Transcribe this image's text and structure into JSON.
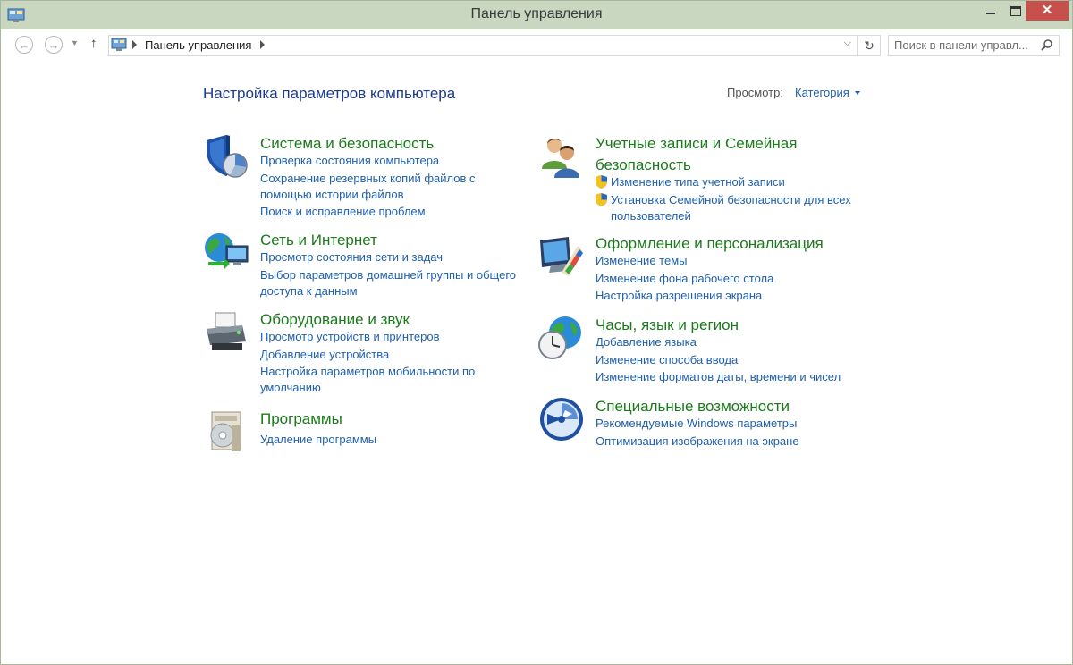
{
  "window": {
    "title": "Панель управления"
  },
  "navbar": {
    "breadcrumb": "Панель управления",
    "search_placeholder": "Поиск в панели управл..."
  },
  "content": {
    "page_title": "Настройка параметров компьютера",
    "view_label": "Просмотр:",
    "view_value": "Категория",
    "categories": [
      {
        "title": "Система и безопасность",
        "icon": "shield-icon",
        "links": [
          "Проверка состояния компьютера",
          "Сохранение резервных копий файлов с помощью истории файлов",
          "Поиск и исправление проблем"
        ]
      },
      {
        "title": "Сеть и Интернет",
        "icon": "network-globe-icon",
        "links": [
          "Просмотр состояния сети и задач",
          "Выбор параметров домашней группы и общего доступа к данным"
        ]
      },
      {
        "title": "Оборудование и звук",
        "icon": "printer-icon",
        "links": [
          "Просмотр устройств и принтеров",
          "Добавление устройства",
          "Настройка параметров мобильности по умолчанию"
        ]
      },
      {
        "title": "Программы",
        "icon": "programs-icon",
        "links": [
          "Удаление программы"
        ]
      },
      {
        "title": "Учетные записи и Семейная безопасность",
        "icon": "users-icon",
        "links": [
          "Изменение типа учетной записи",
          "Установка Семейной безопасности для всех пользователей"
        ]
      },
      {
        "title": "Оформление и персонализация",
        "icon": "monitor-palette-icon",
        "links": [
          "Изменение темы",
          "Изменение фона рабочего стола",
          "Настройка разрешения экрана"
        ]
      },
      {
        "title": "Часы, язык и регион",
        "icon": "clock-globe-icon",
        "links": [
          "Добавление языка",
          "Изменение способа ввода",
          "Изменение форматов даты, времени и чисел"
        ]
      },
      {
        "title": "Специальные возможности",
        "icon": "accessibility-icon",
        "links": [
          "Рекомендуемые Windows параметры",
          "Оптимизация изображения на экране"
        ]
      }
    ]
  },
  "colors": {
    "heading_green": "#1b7a1b",
    "link_blue": "#1f5fad",
    "title_blue": "#1e3a8a",
    "chrome": "#c9d6c0",
    "close_red": "#c7504c"
  }
}
